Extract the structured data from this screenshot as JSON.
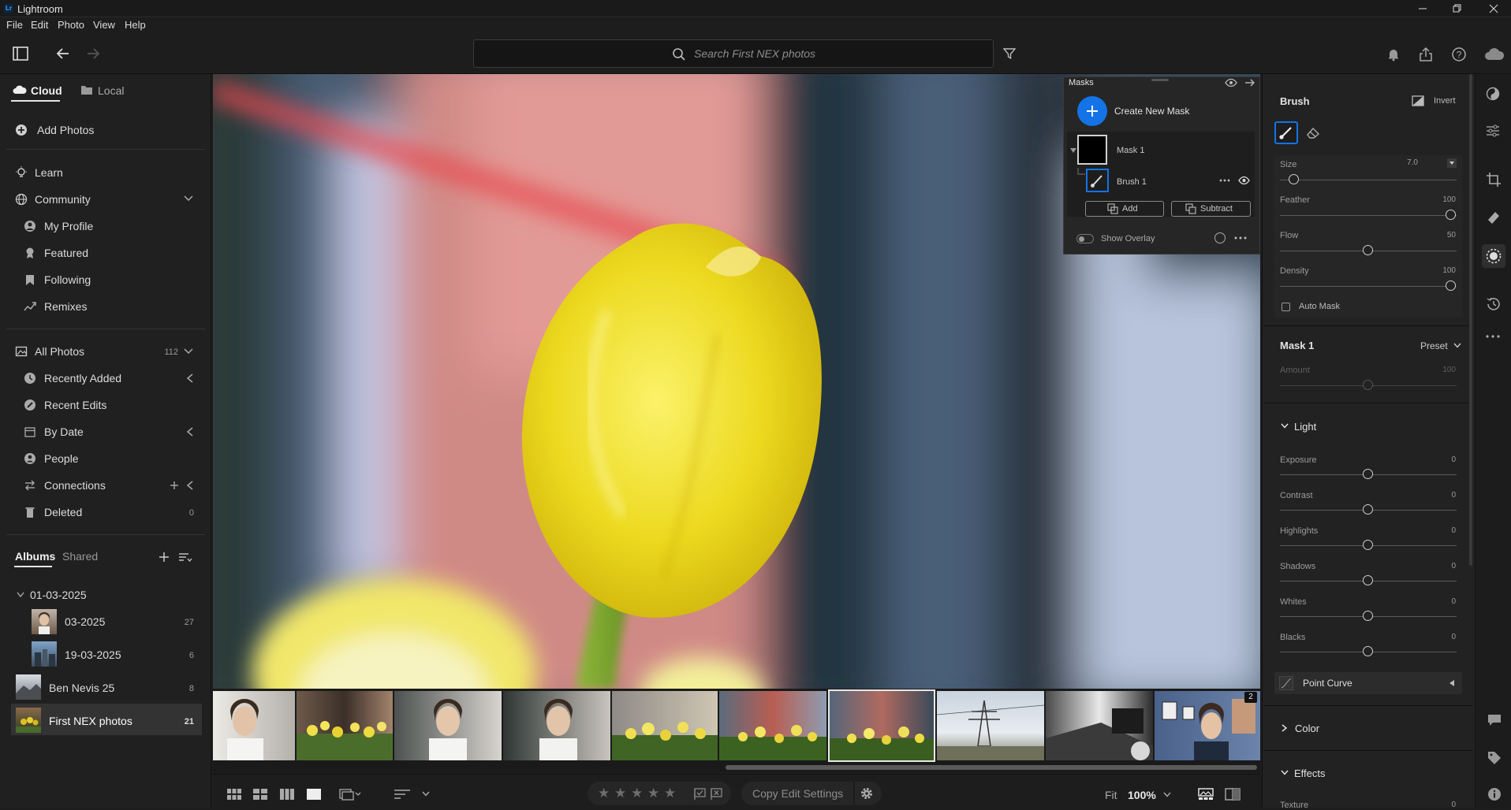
{
  "app": {
    "title": "Lightroom",
    "logo": "Lr"
  },
  "menu": [
    "File",
    "Edit",
    "Photo",
    "View",
    "Help"
  ],
  "search": {
    "placeholder": "Search First NEX photos"
  },
  "left": {
    "tabs": {
      "cloud": "Cloud",
      "local": "Local"
    },
    "add_photos": "Add Photos",
    "learn": "Learn",
    "community": "Community",
    "community_items": [
      "My Profile",
      "Featured",
      "Following",
      "Remixes"
    ],
    "all_photos": {
      "label": "All Photos",
      "count": "112"
    },
    "photo_items": [
      {
        "label": "Recently Added",
        "count": ""
      },
      {
        "label": "Recent Edits",
        "count": ""
      },
      {
        "label": "By Date",
        "count": ""
      },
      {
        "label": "People",
        "count": ""
      },
      {
        "label": "Connections",
        "count": ""
      },
      {
        "label": "Deleted",
        "count": "0"
      }
    ],
    "album_tabs": {
      "albums": "Albums",
      "shared": "Shared"
    },
    "folder": "01-03-2025",
    "albums": [
      {
        "label": "03-2025",
        "count": "27"
      },
      {
        "label": "19-03-2025",
        "count": "6"
      },
      {
        "label": "Ben Nevis 25",
        "count": "8"
      },
      {
        "label": "First NEX photos",
        "count": "21"
      }
    ]
  },
  "masks": {
    "title": "Masks",
    "create": "Create New Mask",
    "mask_name": "Mask 1",
    "brush_name": "Brush 1",
    "add": "Add",
    "subtract": "Subtract",
    "show_overlay": "Show Overlay"
  },
  "right": {
    "brush_title": "Brush",
    "invert": "Invert",
    "brush_sliders": [
      {
        "label": "Size",
        "value": "7.0",
        "pos": 0.05
      },
      {
        "label": "Feather",
        "value": "100",
        "pos": 1.0
      },
      {
        "label": "Flow",
        "value": "50",
        "pos": 0.5
      },
      {
        "label": "Density",
        "value": "100",
        "pos": 1.0
      }
    ],
    "auto_mask": "Auto Mask",
    "mask_section": "Mask 1",
    "preset": "Preset",
    "amount": {
      "label": "Amount",
      "value": "100",
      "pos": 0.5
    },
    "light": "Light",
    "light_sliders": [
      {
        "label": "Exposure",
        "value": "0",
        "pos": 0.5
      },
      {
        "label": "Contrast",
        "value": "0",
        "pos": 0.5
      },
      {
        "label": "Highlights",
        "value": "0",
        "pos": 0.5
      },
      {
        "label": "Shadows",
        "value": "0",
        "pos": 0.5
      },
      {
        "label": "Whites",
        "value": "0",
        "pos": 0.5
      },
      {
        "label": "Blacks",
        "value": "0",
        "pos": 0.5
      }
    ],
    "point_curve": "Point Curve",
    "color": "Color",
    "effects": "Effects",
    "texture": {
      "label": "Texture",
      "value": "0"
    }
  },
  "filmstrip": {
    "badge": "2"
  },
  "bottom": {
    "copy_edit": "Copy Edit Settings",
    "fit": "Fit",
    "zoom": "100%"
  }
}
